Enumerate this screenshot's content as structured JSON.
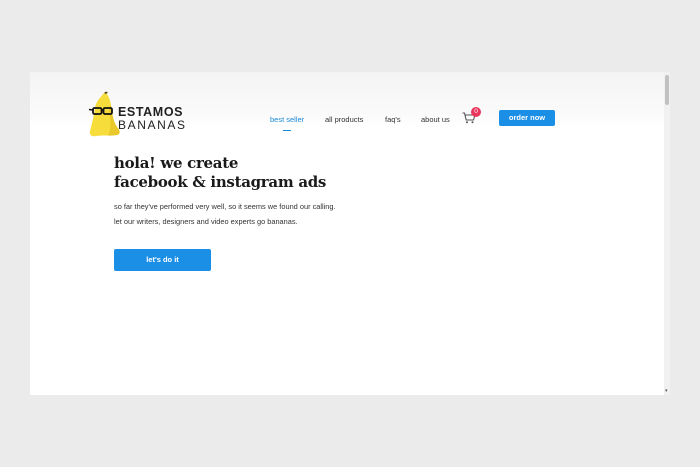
{
  "header": {
    "logo_line1": "ESTAMOS",
    "logo_line2": "BANANAS",
    "nav": [
      {
        "label": "best seller",
        "active": true
      },
      {
        "label": "all products",
        "active": false
      },
      {
        "label": "faq's",
        "active": false
      },
      {
        "label": "about us",
        "active": false
      }
    ],
    "cart_count": "0",
    "order_label": "order now"
  },
  "hero": {
    "headline_line1": "hola! we create",
    "headline_line2": "facebook & instagram ads",
    "sub_line1": "so far they've performed very well, so it seems we found our calling.",
    "sub_line2": "let our writers, designers and video experts go bananas.",
    "cta_label": "let's do it"
  },
  "colors": {
    "accent": "#1b8ee6",
    "badge": "#e8365d",
    "banana": "#f6dd3c"
  }
}
